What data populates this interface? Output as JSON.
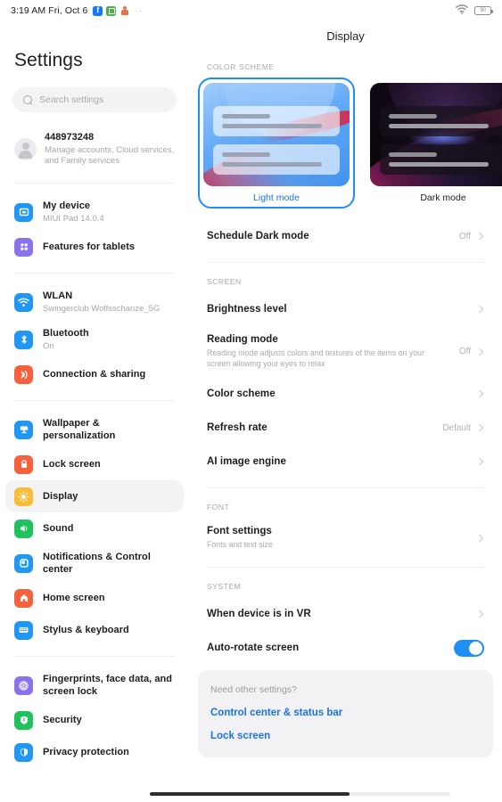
{
  "statusbar": {
    "time": "3:19 AM Fri, Oct 6",
    "app_icons": [
      "facebook-icon",
      "green-app-icon",
      "person-app-icon"
    ],
    "overflow": "··",
    "wifi_icon": "wifi-icon",
    "battery_label": "90"
  },
  "sidebar": {
    "title": "Settings",
    "search": {
      "placeholder": "Search settings",
      "value": ""
    },
    "account": {
      "name": "448973248",
      "subtitle": "Manage accounts, Cloud services, and Family services"
    },
    "groups": [
      {
        "items": [
          {
            "label": "My device",
            "sub": "MIUI Pad 14.0.4",
            "icon": "device-icon",
            "color": "#2196f3",
            "selected": false
          },
          {
            "label": "Features for tablets",
            "sub": "",
            "icon": "grid-icon",
            "color": "#8b72ec",
            "selected": false
          }
        ]
      },
      {
        "items": [
          {
            "label": "WLAN",
            "sub": "Swingerclub Wolfsschanze_5G",
            "icon": "wifi-icon",
            "color": "#2196f3",
            "selected": false
          },
          {
            "label": "Bluetooth",
            "sub": "On",
            "icon": "bluetooth-icon",
            "color": "#2196f3",
            "selected": false
          },
          {
            "label": "Connection & sharing",
            "sub": "",
            "icon": "connection-icon",
            "color": "#f4613c",
            "selected": false
          }
        ]
      },
      {
        "items": [
          {
            "label": "Wallpaper & personalization",
            "sub": "",
            "icon": "wallpaper-icon",
            "color": "#2196f3",
            "selected": false
          },
          {
            "label": "Lock screen",
            "sub": "",
            "icon": "lock-icon",
            "color": "#f4613c",
            "selected": false
          },
          {
            "label": "Display",
            "sub": "",
            "icon": "brightness-icon",
            "color": "#fbbb36",
            "selected": true
          },
          {
            "label": "Sound",
            "sub": "",
            "icon": "speaker-icon",
            "color": "#21c25e",
            "selected": false
          },
          {
            "label": "Notifications & Control center",
            "sub": "",
            "icon": "notification-icon",
            "color": "#2196f3",
            "selected": false
          },
          {
            "label": "Home screen",
            "sub": "",
            "icon": "home-icon",
            "color": "#f4613c",
            "selected": false
          },
          {
            "label": "Stylus & keyboard",
            "sub": "",
            "icon": "keyboard-icon",
            "color": "#2196f3",
            "selected": false
          }
        ]
      },
      {
        "items": [
          {
            "label": "Fingerprints, face data, and screen lock",
            "sub": "",
            "icon": "fingerprint-icon",
            "color": "#8b72ec",
            "selected": false
          },
          {
            "label": "Security",
            "sub": "",
            "icon": "security-shield-icon",
            "color": "#21c25e",
            "selected": false
          },
          {
            "label": "Privacy protection",
            "sub": "",
            "icon": "privacy-icon",
            "color": "#2196f3",
            "selected": false
          }
        ]
      }
    ]
  },
  "main": {
    "title": "Display",
    "color_scheme": {
      "section_label": "COLOR SCHEME",
      "options": [
        {
          "label": "Light mode",
          "selected": true
        },
        {
          "label": "Dark mode",
          "selected": false
        }
      ]
    },
    "schedule_row": {
      "title": "Schedule Dark mode",
      "value": "Off",
      "chevron": "chevron-right-icon"
    },
    "screen_section": {
      "label": "SCREEN",
      "rows": [
        {
          "title": "Brightness level",
          "desc": "",
          "value": ""
        },
        {
          "title": "Reading mode",
          "desc": "Reading mode adjusts colors and textures of the items on your screen allowing your eyes to relax",
          "value": "Off"
        },
        {
          "title": "Color scheme",
          "desc": "",
          "value": ""
        },
        {
          "title": "Refresh rate",
          "desc": "",
          "value": "Default"
        },
        {
          "title": "AI image engine",
          "desc": "",
          "value": ""
        }
      ]
    },
    "font_section": {
      "label": "FONT",
      "rows": [
        {
          "title": "Font settings",
          "desc": "Fonts and text size",
          "value": ""
        }
      ]
    },
    "system_section": {
      "label": "SYSTEM",
      "rows": [
        {
          "title": "When device is in VR",
          "desc": "",
          "value": ""
        }
      ],
      "toggle_row": {
        "title": "Auto-rotate screen",
        "state": "on"
      }
    },
    "help": {
      "question": "Need other settings?",
      "links": [
        "Control center & status bar",
        "Lock screen"
      ]
    }
  }
}
